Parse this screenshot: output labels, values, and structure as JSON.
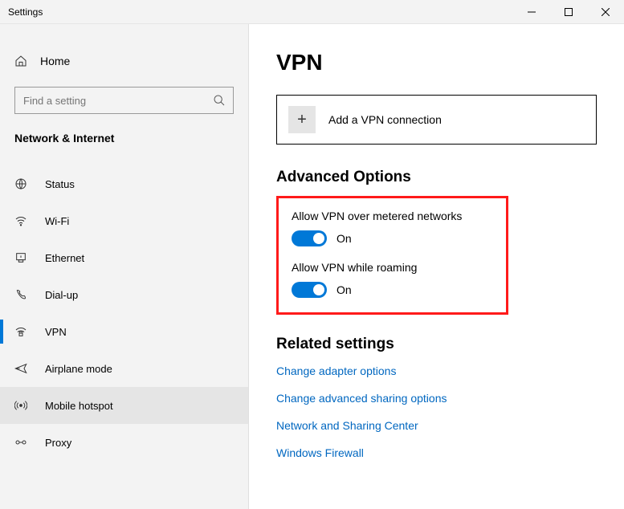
{
  "window": {
    "title": "Settings"
  },
  "sidebar": {
    "home": "Home",
    "search_placeholder": "Find a setting",
    "section": "Network & Internet",
    "items": [
      {
        "label": "Status"
      },
      {
        "label": "Wi-Fi"
      },
      {
        "label": "Ethernet"
      },
      {
        "label": "Dial-up"
      },
      {
        "label": "VPN"
      },
      {
        "label": "Airplane mode"
      },
      {
        "label": "Mobile hotspot"
      },
      {
        "label": "Proxy"
      }
    ]
  },
  "main": {
    "title": "VPN",
    "add_button": "Add a VPN connection",
    "advanced_title": "Advanced Options",
    "toggles": [
      {
        "label": "Allow VPN over metered networks",
        "state": "On"
      },
      {
        "label": "Allow VPN while roaming",
        "state": "On"
      }
    ],
    "related_title": "Related settings",
    "links": [
      "Change adapter options",
      "Change advanced sharing options",
      "Network and Sharing Center",
      "Windows Firewall"
    ]
  }
}
